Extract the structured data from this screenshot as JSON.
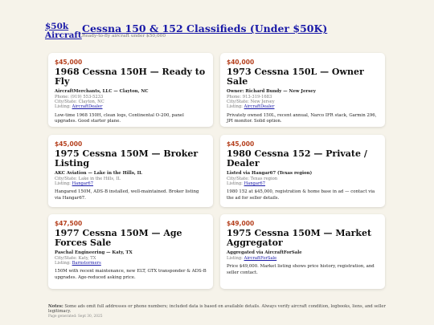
{
  "header": {
    "logo_line1": "$50k",
    "logo_line2": "Aircraft",
    "title": "Cessna 150 & 152 Classifieds (Under $50K)",
    "subtitle": "Ready-to-fly aircraft under $50,000"
  },
  "listings": [
    {
      "price": "$45,000",
      "title": "1968 Cessna 150H — Ready to Fly",
      "seller": "AircraftMerchants, LLC — Clayton, NC",
      "phone": "Phone: (919) 553-5233",
      "city": "City/State: Clayton, NC",
      "listing_prefix": "Listing: ",
      "listing_link": "AircraftDealer",
      "desc": "Low-time 1968 150H, clean logs, Continental O-200, panel upgrades. Good starter plane."
    },
    {
      "price": "$40,000",
      "title": "1973 Cessna 150L — Owner Sale",
      "seller": "Owner: Richard Bundy — New Jersey",
      "phone": "Phone: 913-319-1683",
      "city": "City/State: New Jersey",
      "listing_prefix": "Listing: ",
      "listing_link": "AircraftDealer",
      "desc": "Privately owned 150L, recent annual, Narco IFR stack, Garmin 296, JPI monitor. Solid option."
    },
    {
      "price": "$45,000",
      "title": "1975 Cessna 150M — Broker Listing",
      "seller": "AKC Aviation — Lake in the Hills, IL",
      "phone": "",
      "city": "City/State: Lake in the Hills, IL",
      "listing_prefix": "Listing: ",
      "listing_link": "Hangar67",
      "desc": "Hangared 150M, ADS-B installed, well-maintained. Broker listing via Hangar67."
    },
    {
      "price": "$45,000",
      "title": "1980 Cessna 152 — Private / Dealer",
      "seller": "Listed via Hangar67 (Texas region)",
      "phone": "",
      "city": "City/State: Texas region",
      "listing_prefix": "Listing: ",
      "listing_link": "Hangar67",
      "desc": "1980 152 at $45,000, registration & home base in ad — contact via the ad for seller details."
    },
    {
      "price": "$47,500",
      "title": "1977 Cessna 150M — Age Forces Sale",
      "seller": "Paschal Engineering — Katy, TX",
      "phone": "",
      "city": "City/State: Katy, TX",
      "listing_prefix": "Listing: ",
      "listing_link": "Barnstormers",
      "desc": "150M with recent maintenance, new ELT, GTX transponder & ADS-B upgrades. Age-reduced asking price."
    },
    {
      "price": "$49,000",
      "title": "1975 Cessna 150M — Market Aggregator",
      "seller": "Aggregated via AircraftForSale",
      "phone": "",
      "city": "",
      "listing_prefix": "Listing: ",
      "listing_link": "AircraftForSale",
      "desc": "Price $49,000. Market listing shows price history, registration, and seller contact."
    }
  ],
  "footer": {
    "label": "Notes:",
    "text": " Some ads omit full addresses or phone numbers; included data is based on available details. Always verify aircraft condition, logbooks, liens, and seller legitimacy.",
    "generated": "Page generated: Sept 30, 2025"
  },
  "colors": {
    "background": "#f6f3ea",
    "price": "#b5401e",
    "link": "#1a1aa8"
  }
}
